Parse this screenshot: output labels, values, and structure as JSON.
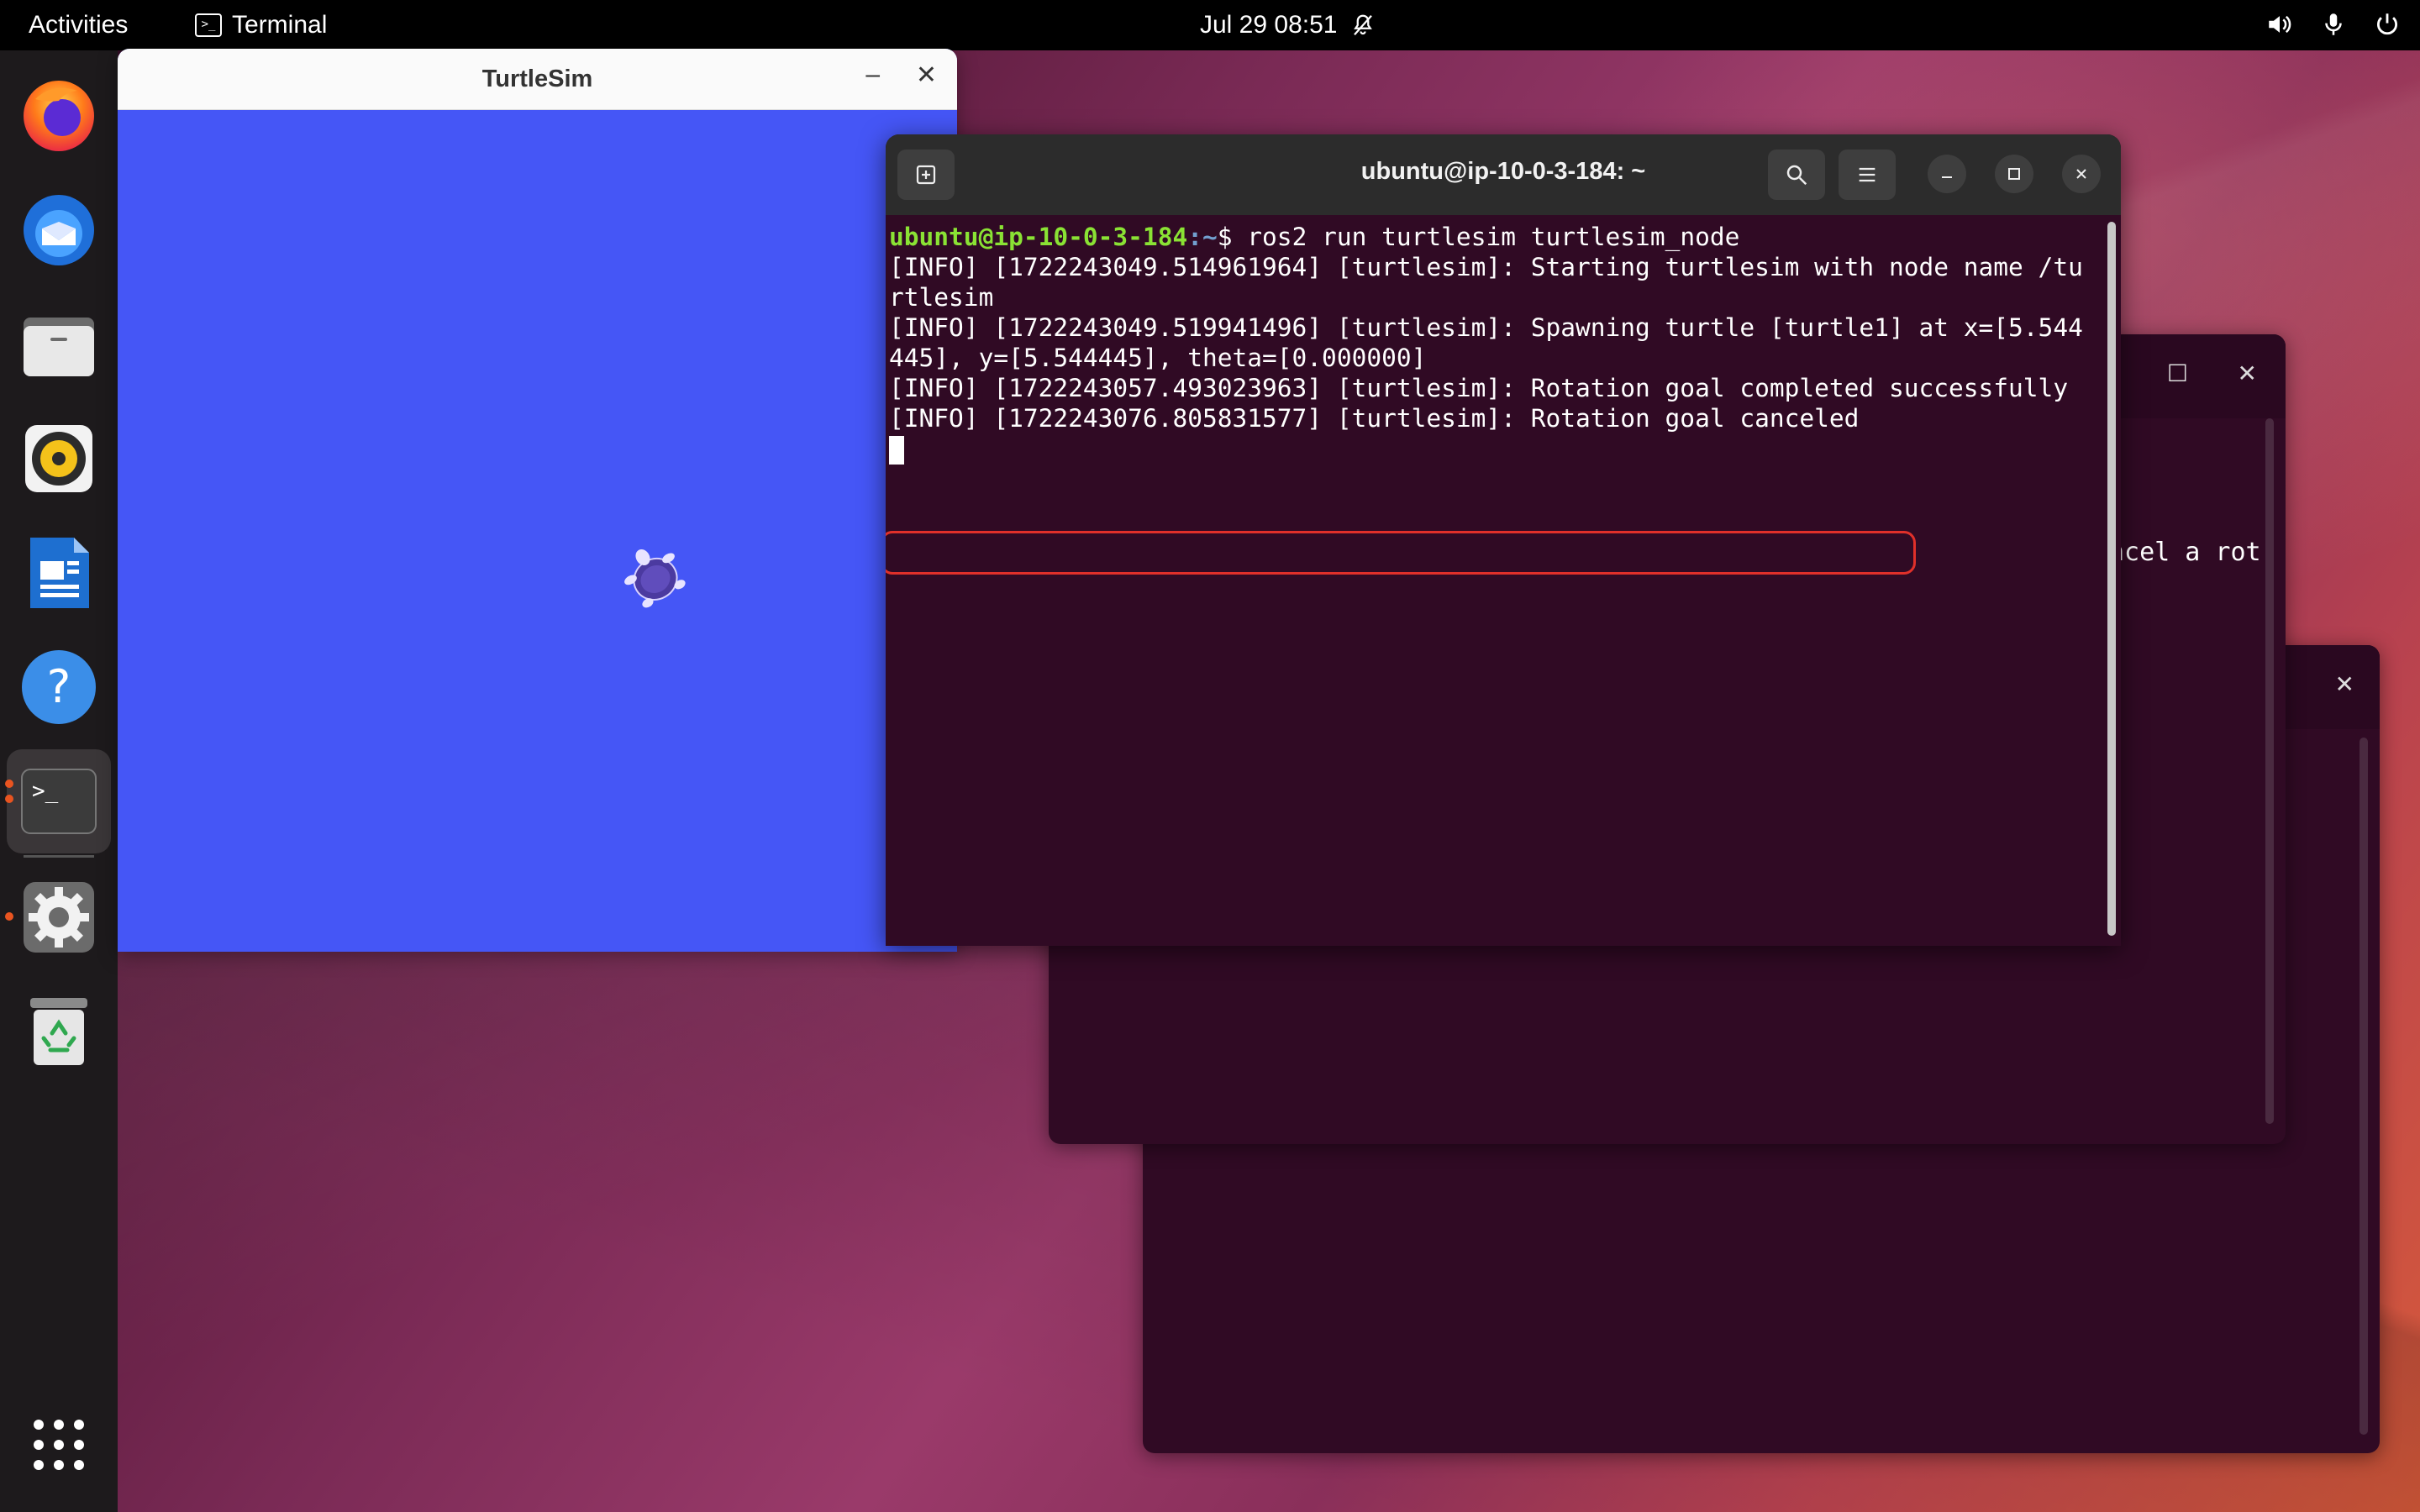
{
  "topbar": {
    "activities": "Activities",
    "app_name": "Terminal",
    "app_icon": "terminal-icon",
    "clock": "Jul 29  08:51",
    "icons": [
      "notifications-muted-icon",
      "volume-icon",
      "microphone-icon",
      "power-icon"
    ]
  },
  "dock": {
    "items": [
      {
        "name": "firefox",
        "icon": "firefox-icon",
        "running": false
      },
      {
        "name": "thunderbird",
        "icon": "thunderbird-icon",
        "running": false
      },
      {
        "name": "files",
        "icon": "files-icon",
        "running": false
      },
      {
        "name": "rhythmbox",
        "icon": "rhythmbox-icon",
        "running": false
      },
      {
        "name": "libreoffice-writer",
        "icon": "writer-icon",
        "running": false
      },
      {
        "name": "help",
        "icon": "help-icon",
        "running": false
      },
      {
        "name": "terminal",
        "icon": "terminal-icon",
        "running": true
      },
      {
        "name": "settings",
        "icon": "settings-icon",
        "running": true
      },
      {
        "name": "trash",
        "icon": "trash-icon",
        "running": false
      }
    ],
    "show_apps_icon": "app-grid-icon"
  },
  "turtlesim": {
    "title": "TurtleSim",
    "minimize": "–",
    "close": "✕",
    "background_color": "#4556f6"
  },
  "terminal": {
    "title": "ubuntu@ip-10-0-3-184: ~",
    "prompt_user": "ubuntu@ip-10-0-3-184",
    "prompt_path": ":~",
    "prompt_symbol": "$ ",
    "command": "ros2 run turtlesim turtlesim_node",
    "output": [
      "[INFO] [1722243049.514961964] [turtlesim]: Starting turtlesim with node name /tu",
      "rtlesim",
      "[INFO] [1722243049.519941496] [turtlesim]: Spawning turtle [turtle1] at x=[5.544",
      "445], y=[5.544445], theta=[0.000000]",
      "[INFO] [1722243057.493023963] [turtlesim]: Rotation goal completed successfully",
      "[INFO] [1722243076.805831577] [turtlesim]: Rotation goal canceled"
    ]
  },
  "background_terminal": {
    "partial_text": "ncel a rot"
  },
  "colors": {
    "terminal_bg": "#300a24",
    "prompt_green": "#8ae234",
    "prompt_blue": "#729fcf",
    "highlight_red": "#e0302a",
    "accent_orange": "#e95420"
  }
}
